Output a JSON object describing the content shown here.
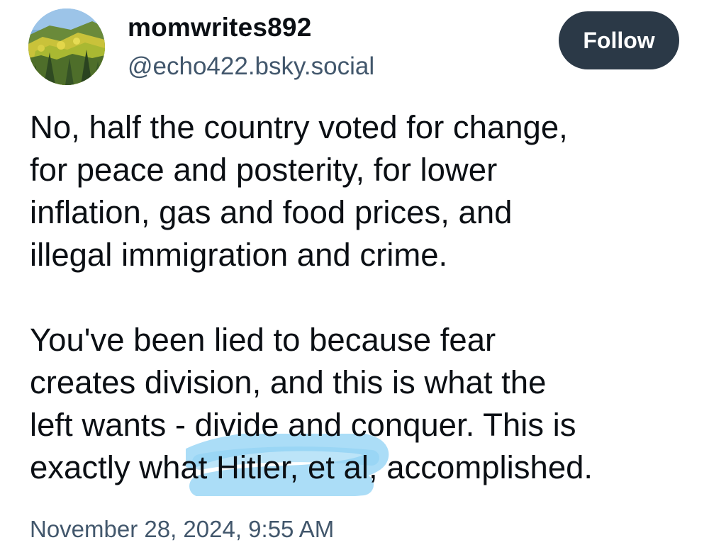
{
  "author": {
    "display_name": "momwrites892",
    "handle": "@echo422.bsky.social",
    "avatar_icon": "landscape-avatar"
  },
  "follow_button": {
    "label": "Follow",
    "color": "#2b3947"
  },
  "post": {
    "paragraph_1": [
      "No, half the country voted for change,",
      "for peace and posterity, for lower",
      "inflation, gas and food prices, and",
      "illegal immigration and crime."
    ],
    "paragraph_2": [
      "You've been lied to because fear",
      "creates division, and this is what the",
      "left wants - divide and conquer. This is",
      "exactly what Hitler, et al, accomplished."
    ],
    "highlight_color": "#8fd2f4",
    "timestamp": "November 28, 2024, 9:55 AM"
  }
}
